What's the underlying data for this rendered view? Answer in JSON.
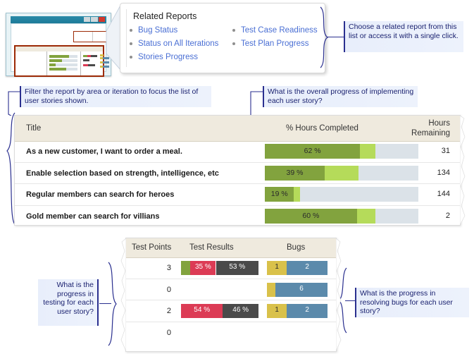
{
  "thumbnail": {
    "name": "report-window-thumbnail",
    "title_bar_color": "#1d7b99",
    "highlight_color": "#9c2a06"
  },
  "related_reports": {
    "title": "Related Reports",
    "column_1": [
      {
        "label": "Bug Status"
      },
      {
        "label": "Status on All Iterations"
      },
      {
        "label": "Stories Progress"
      }
    ],
    "column_2": [
      {
        "label": "Test Case Readiness"
      },
      {
        "label": "Test Plan Progress"
      }
    ],
    "link_color": "#4a6fd4"
  },
  "callouts": {
    "related_reports": "Choose a related report from this list or access it with a single click.",
    "filter": "Filter the report by area or iteration to focus the list of user stories shown.",
    "overall_progress": "What is the overall progress of implementing each user story?",
    "testing_progress": "What is the progress in testing for each user story?",
    "bug_progress": "What is the progress in resolving bugs for each user story?"
  },
  "stories_table": {
    "headers": {
      "title": "Title",
      "percent_hours_completed": "% Hours Completed",
      "hours_remaining": "Hours\nRemaining",
      "hours_remaining_line1": "Hours",
      "hours_remaining_line2": "Remaining"
    },
    "rows": [
      {
        "title": "As a new customer, I want to order a meal.",
        "percent_label": "62 %",
        "completed_pct": 62,
        "in_progress_pct": 10,
        "hours_remaining": "31"
      },
      {
        "title": "Enable selection based on strength, intelligence, etc",
        "percent_label": "39 %",
        "completed_pct": 39,
        "in_progress_pct": 22,
        "hours_remaining": "134"
      },
      {
        "title": "Regular members can search for heroes",
        "percent_label": "19 %",
        "completed_pct": 19,
        "in_progress_pct": 4,
        "hours_remaining": "144"
      },
      {
        "title": "Gold member can search for villians",
        "percent_label": "60 %",
        "completed_pct": 60,
        "in_progress_pct": 12,
        "hours_remaining": "2"
      }
    ],
    "colors": {
      "completed": "#82a33e",
      "in_progress": "#b5db5a",
      "remaining": "#dbe2e8",
      "header_bg": "#efeade"
    }
  },
  "test_table": {
    "headers": {
      "test_points": "Test Points",
      "test_results": "Test Results",
      "bugs": "Bugs"
    },
    "rows": [
      {
        "test_points": "3",
        "results": [
          {
            "kind": "passed",
            "label": "",
            "pct": 12,
            "color": "#82a33e"
          },
          {
            "kind": "failed",
            "label": "35 %",
            "pct": 33,
            "color": "#dc3b55"
          },
          {
            "kind": "not-run",
            "label": "53 %",
            "pct": 55,
            "color": "#4a4a4a"
          }
        ],
        "bugs": [
          {
            "kind": "active",
            "label": "1",
            "pct": 33,
            "color": "#d9c14a"
          },
          {
            "kind": "resolved",
            "label": "2",
            "pct": 67,
            "color": "#5b8aab"
          }
        ]
      },
      {
        "test_points": "0",
        "results": [],
        "bugs": [
          {
            "kind": "active",
            "label": "",
            "pct": 14,
            "color": "#d9c14a"
          },
          {
            "kind": "resolved",
            "label": "6",
            "pct": 86,
            "color": "#5b8aab"
          }
        ]
      },
      {
        "test_points": "2",
        "results": [
          {
            "kind": "failed",
            "label": "54 %",
            "pct": 54,
            "color": "#dc3b55"
          },
          {
            "kind": "not-run",
            "label": "46 %",
            "pct": 46,
            "color": "#4a4a4a"
          }
        ],
        "bugs": [
          {
            "kind": "active",
            "label": "1",
            "pct": 33,
            "color": "#d9c14a"
          },
          {
            "kind": "resolved",
            "label": "2",
            "pct": 67,
            "color": "#5b8aab"
          }
        ]
      },
      {
        "test_points": "0",
        "results": [],
        "bugs": []
      }
    ]
  }
}
